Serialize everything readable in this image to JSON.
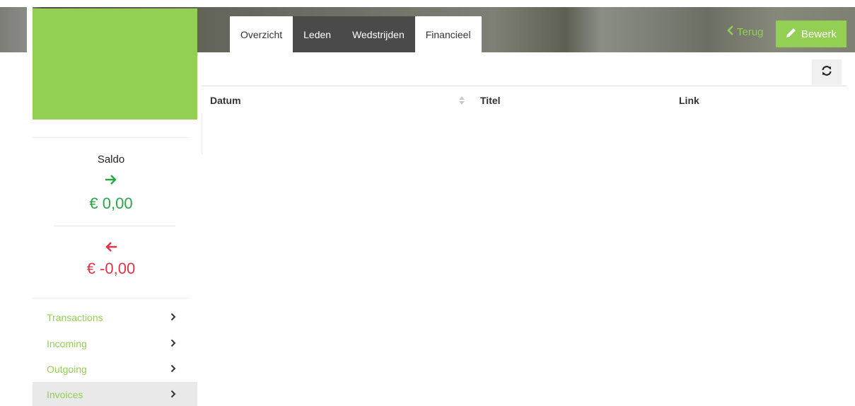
{
  "tabs": [
    {
      "label": "Overzicht",
      "active": false
    },
    {
      "label": "Leden",
      "active": false
    },
    {
      "label": "Wedstrijden",
      "active": false
    },
    {
      "label": "Financieel",
      "active": true
    }
  ],
  "header_actions": {
    "back_label": "Terug",
    "edit_label": "Bewerk"
  },
  "table": {
    "columns": [
      "Datum",
      "Titel",
      "Link"
    ],
    "rows": []
  },
  "saldo": {
    "title": "Saldo",
    "incoming_amount": "€ 0,00",
    "outgoing_amount": "€ -0,00"
  },
  "menu": {
    "items": [
      {
        "label": "Transactions",
        "active": false
      },
      {
        "label": "Incoming",
        "active": false
      },
      {
        "label": "Outgoing",
        "active": false
      },
      {
        "label": "Invoices",
        "active": true
      }
    ]
  },
  "colors": {
    "brand_green": "#92cf52",
    "positive": "#28a745",
    "negative": "#dc3545"
  },
  "icons": {
    "incoming": "arrow-right-icon",
    "outgoing": "arrow-left-icon",
    "refresh": "refresh-icon",
    "edit": "pencil-icon",
    "back": "chevron-left-icon",
    "menu_chevron": "chevron-right-icon",
    "sort": "sort-icon"
  }
}
